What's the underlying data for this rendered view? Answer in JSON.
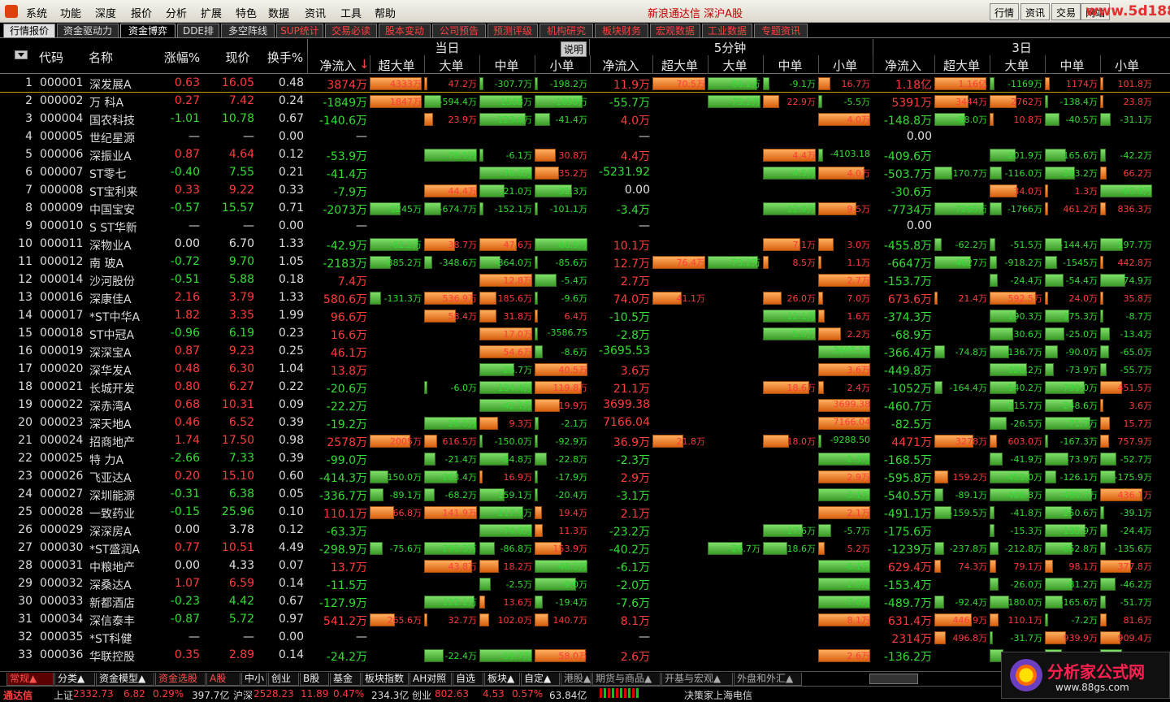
{
  "menubar": {
    "items": [
      "系统",
      "功能",
      "深度",
      "报价",
      "分析",
      "扩展",
      "特色",
      "数据",
      "资讯",
      "工具",
      "帮助"
    ],
    "brand": "新浪通达信 深沪A股",
    "right_buttons": [
      "行情",
      "资讯",
      "交易",
      "网站"
    ],
    "watermark": "www.5d188.com"
  },
  "tabs": [
    "行情报价",
    "资金驱动力",
    "资金博弈",
    "DDE排名",
    "多空阵线",
    "SUP统计",
    "交易必读",
    "股本变动",
    "公司预告",
    "预测评级",
    "机构研究",
    "板块财务",
    "宏观数据",
    "工业数据",
    "专题资讯"
  ],
  "header": {
    "groups": [
      "当日",
      "5分钟",
      "3日"
    ],
    "explain_button": "说明",
    "left_cols": [
      "代码",
      "名称",
      "涨幅%",
      "现价",
      "换手%"
    ],
    "sub_cols": [
      "净流入",
      "超大单",
      "大单",
      "中单",
      "小单"
    ],
    "sort_mark": "↓"
  },
  "colors": {
    "up": "#ff3b3b",
    "down": "#33dd33",
    "flat": "#e0e0e0",
    "bar_green": "#52c23a",
    "bar_orange": "#f08a30"
  },
  "rows": [
    [
      "1",
      "000001",
      "深发展A",
      "0.63",
      "16.05",
      "0.48",
      "3874万",
      "4333万",
      "47.2万",
      "-307.7万",
      "-198.2万",
      "11.9万",
      "70.5万",
      "-66.2万",
      "-9.1万",
      "16.7万",
      "1.18亿",
      "1.16亿",
      "-1169万",
      "1174万",
      "101.8万"
    ],
    [
      "2",
      "000002",
      "万 科A",
      "0.27",
      "7.42",
      "0.24",
      "-1849万",
      "1847万",
      "-594.4万",
      "-1508万",
      "-1690万",
      "-55.7万",
      "",
      "-73.2万",
      "22.9万",
      "-5.5万",
      "5391万",
      "3444万",
      "2762万",
      "-138.4万",
      "23.8万"
    ],
    [
      "3",
      "000004",
      "国农科技",
      "-1.01",
      "10.78",
      "0.67",
      "-140.6万",
      "",
      "23.9万",
      "-123.0万",
      "-41.4万",
      "4.0万",
      "",
      "",
      "",
      "4.0万",
      "-148.8万",
      "-88.0万",
      "10.8万",
      "-40.5万",
      "-31.1万"
    ],
    [
      "4",
      "000005",
      "世纪星源",
      "—",
      "—",
      "0.00",
      "—",
      "",
      "",
      "",
      "",
      "—",
      "",
      "",
      "",
      "",
      "0.00",
      "",
      "",
      "",
      ""
    ],
    [
      "5",
      "000006",
      "深振业A",
      "0.87",
      "4.64",
      "0.12",
      "-53.9万",
      "",
      "-78.5万",
      "-6.1万",
      "30.8万",
      "4.4万",
      "",
      "",
      "4.4万",
      "-4103.18",
      "-409.6万",
      "",
      "-201.9万",
      "-165.6万",
      "-42.2万"
    ],
    [
      "6",
      "000007",
      "ST零七",
      "-0.40",
      "7.55",
      "0.21",
      "-41.4万",
      "",
      "",
      "-76.6万",
      "35.2万",
      "-5231.92",
      "",
      "",
      "-4.5万",
      "4.0万",
      "-503.7万",
      "-170.7万",
      "-116.0万",
      "-283.2万",
      "66.2万"
    ],
    [
      "7",
      "000008",
      "ST宝利来",
      "0.33",
      "9.22",
      "0.33",
      "-7.9万",
      "",
      "44.4万",
      "-21.0万",
      "-31.3万",
      "0.00",
      "",
      "",
      "",
      "",
      "-30.6万",
      "",
      "34.0万",
      "1.3万",
      "-65.8万"
    ],
    [
      "8",
      "000009",
      "中国宝安",
      "-0.57",
      "15.57",
      "0.71",
      "-2073万",
      "-1245万",
      "-674.7万",
      "-152.1万",
      "-101.1万",
      "-3.4万",
      "",
      "",
      "-12.9万",
      "9.5万",
      "-7734万",
      "-7265万",
      "-1766万",
      "461.2万",
      "836.3万"
    ],
    [
      "9",
      "000010",
      "S ST华新",
      "—",
      "—",
      "0.00",
      "—",
      "",
      "",
      "",
      "",
      "—",
      "",
      "",
      "",
      "",
      "0.00",
      "",
      "",
      "",
      ""
    ],
    [
      "10",
      "000011",
      "深物业A",
      "0.00",
      "6.70",
      "1.33",
      "-42.9万",
      "-62.2万",
      "38.7万",
      "47.6万",
      "-66.9万",
      "10.1万",
      "",
      "",
      "7.1万",
      "3.0万",
      "-455.8万",
      "-62.2万",
      "-51.5万",
      "-144.4万",
      "-197.7万"
    ],
    [
      "11",
      "000012",
      "南 玻A",
      "-0.72",
      "9.70",
      "1.05",
      "-2183万",
      "-885.2万",
      "-348.6万",
      "-864.0万",
      "-85.6万",
      "12.7万",
      "76.4万",
      "-73.2万",
      "8.5万",
      "1.1万",
      "-6647万",
      "-4627万",
      "-918.2万",
      "-1545万",
      "442.8万"
    ],
    [
      "12",
      "000014",
      "沙河股份",
      "-0.51",
      "5.88",
      "0.18",
      "7.4万",
      "",
      "",
      "12.8万",
      "-5.4万",
      "2.7万",
      "",
      "",
      "",
      "2.7万",
      "-153.7万",
      "",
      "-24.4万",
      "-54.4万",
      "-74.9万"
    ],
    [
      "13",
      "000016",
      "深康佳A",
      "2.16",
      "3.79",
      "1.33",
      "580.6万",
      "-131.3万",
      "536.9万",
      "185.6万",
      "-9.6万",
      "74.0万",
      "41.1万",
      "",
      "26.0万",
      "7.0万",
      "673.6万",
      "21.4万",
      "592.5万",
      "24.0万",
      "35.8万"
    ],
    [
      "14",
      "000017",
      "*ST中华A",
      "1.82",
      "3.35",
      "1.99",
      "96.6万",
      "",
      "58.4万",
      "31.8万",
      "6.4万",
      "-10.5万",
      "",
      "",
      "-12.1万",
      "1.6万",
      "-374.3万",
      "",
      "-190.3万",
      "-175.3万",
      "-8.7万"
    ],
    [
      "15",
      "000018",
      "ST中冠A",
      "-0.96",
      "6.19",
      "0.23",
      "16.6万",
      "",
      "",
      "17.0万",
      "-3586.75",
      "-2.8万",
      "",
      "",
      "-5.0万",
      "2.2万",
      "-68.9万",
      "",
      "-30.6万",
      "-25.0万",
      "-13.4万"
    ],
    [
      "16",
      "000019",
      "深深宝A",
      "0.87",
      "9.23",
      "0.25",
      "46.1万",
      "",
      "",
      "54.6万",
      "-8.6万",
      "-3695.53",
      "",
      "",
      "",
      "-3695.53",
      "-366.4万",
      "-74.8万",
      "-136.7万",
      "-90.0万",
      "-65.0万"
    ],
    [
      "17",
      "000020",
      "深华发A",
      "0.48",
      "6.30",
      "1.04",
      "13.8万",
      "",
      "",
      "-26.7万",
      "40.5万",
      "3.6万",
      "",
      "",
      "",
      "3.6万",
      "-449.8万",
      "",
      "-320.2万",
      "-73.9万",
      "-55.7万"
    ],
    [
      "18",
      "000021",
      "长城开发",
      "0.80",
      "6.27",
      "0.22",
      "-20.6万",
      "",
      "-6.0万",
      "-134.4万",
      "119.8万",
      "21.1万",
      "",
      "",
      "18.6万",
      "2.4万",
      "-1052万",
      "-164.4万",
      "-540.2万",
      "-799.0万",
      "451.5万"
    ],
    [
      "19",
      "000022",
      "深赤湾A",
      "0.68",
      "10.31",
      "0.09",
      "-22.2万",
      "",
      "",
      "-42.1万",
      "19.9万",
      "3699.38",
      "",
      "",
      "",
      "3699.38",
      "-460.7万",
      "",
      "-215.7万",
      "-248.6万",
      "3.6万"
    ],
    [
      "20",
      "000023",
      "深天地A",
      "0.46",
      "6.52",
      "0.39",
      "-19.2万",
      "",
      "-26.5万",
      "9.3万",
      "-2.1万",
      "7166.04",
      "",
      "",
      "",
      "7166.04",
      "-82.5万",
      "",
      "-26.5万",
      "-71.7万",
      "15.7万"
    ],
    [
      "21",
      "000024",
      "招商地产",
      "1.74",
      "17.50",
      "0.98",
      "2578万",
      "2005万",
      "616.5万",
      "-150.0万",
      "-92.9万",
      "36.9万",
      "21.8万",
      "",
      "18.0万",
      "-9288.50",
      "4471万",
      "3278万",
      "603.0万",
      "-167.3万",
      "757.9万"
    ],
    [
      "22",
      "000025",
      "特 力A",
      "-2.66",
      "7.33",
      "0.39",
      "-99.0万",
      "",
      "-21.4万",
      "-54.8万",
      "-22.8万",
      "-2.3万",
      "",
      "",
      "",
      "-2.3万",
      "-168.5万",
      "",
      "-41.9万",
      "-73.9万",
      "-52.7万"
    ],
    [
      "23",
      "000026",
      "飞亚达A",
      "0.20",
      "15.10",
      "0.60",
      "-414.3万",
      "-150.0万",
      "-263.4万",
      "16.9万",
      "-17.9万",
      "2.9万",
      "",
      "",
      "",
      "2.9万",
      "-595.8万",
      "159.2万",
      "-453.0万",
      "-126.1万",
      "-175.9万"
    ],
    [
      "24",
      "000027",
      "深圳能源",
      "-0.31",
      "6.38",
      "0.05",
      "-336.7万",
      "-89.1万",
      "-68.2万",
      "-159.1万",
      "-20.4万",
      "-3.1万",
      "",
      "",
      "",
      "-3.1万",
      "-540.5万",
      "-89.1万",
      "-406.8万",
      "-480.7万",
      "436.1万"
    ],
    [
      "25",
      "000028",
      "一致药业",
      "-0.15",
      "25.96",
      "0.10",
      "110.1万",
      "66.8万",
      "141.9万",
      "-117.9万",
      "19.4万",
      "2.1万",
      "",
      "",
      "",
      "2.1万",
      "-491.1万",
      "-159.5万",
      "-41.8万",
      "-250.6万",
      "-39.1万"
    ],
    [
      "26",
      "000029",
      "深深房A",
      "0.00",
      "3.78",
      "0.12",
      "-63.3万",
      "",
      "",
      "-74.6万",
      "11.3万",
      "-23.2万",
      "",
      "",
      "-17.6万",
      "-5.7万",
      "-175.6万",
      "",
      "-15.3万",
      "-135.9万",
      "-24.4万"
    ],
    [
      "27",
      "000030",
      "*ST盛润A",
      "0.77",
      "10.51",
      "4.49",
      "-298.9万",
      "-75.6万",
      "-290.3万",
      "-86.8万",
      "153.9万",
      "-40.2万",
      "",
      "-26.7万",
      "-18.6万",
      "5.2万",
      "-1239万",
      "-237.8万",
      "-212.8万",
      "-652.8万",
      "-135.6万"
    ],
    [
      "28",
      "000031",
      "中粮地产",
      "0.00",
      "4.33",
      "0.07",
      "13.7万",
      "",
      "43.8万",
      "18.2万",
      "-48.3万",
      "-6.1万",
      "",
      "",
      "",
      "-6.1万",
      "629.4万",
      "74.3万",
      "79.1万",
      "98.1万",
      "377.8万"
    ],
    [
      "29",
      "000032",
      "深桑达A",
      "1.07",
      "6.59",
      "0.14",
      "-11.5万",
      "",
      "",
      "-2.5万",
      "-9.0万",
      "-2.0万",
      "",
      "",
      "",
      "-2.0万",
      "-153.4万",
      "",
      "-26.0万",
      "-81.2万",
      "-46.2万"
    ],
    [
      "30",
      "000033",
      "新都酒店",
      "-0.23",
      "4.42",
      "0.67",
      "-127.9万",
      "",
      "-122.1万",
      "13.6万",
      "-19.4万",
      "-7.6万",
      "",
      "",
      "",
      "-7.6万",
      "-489.7万",
      "-92.4万",
      "-180.0万",
      "-165.6万",
      "-51.7万"
    ],
    [
      "31",
      "000034",
      "深信泰丰",
      "-0.87",
      "5.72",
      "0.97",
      "541.2万",
      "265.6万",
      "32.7万",
      "102.0万",
      "140.7万",
      "8.1万",
      "",
      "",
      "",
      "8.1万",
      "631.4万",
      "446.9万",
      "110.1万",
      "-7.2万",
      "81.6万"
    ],
    [
      "32",
      "000035",
      "*ST科健",
      "—",
      "—",
      "0.00",
      "—",
      "",
      "",
      "",
      "",
      "—",
      "",
      "",
      "",
      "",
      "2314万",
      "496.8万",
      "-31.7万",
      "939.9万",
      "909.4万"
    ],
    [
      "33",
      "000036",
      "华联控股",
      "0.35",
      "2.89",
      "0.14",
      "-24.2万",
      "",
      "-22.4万",
      "-59.7万",
      "58.0万",
      "2.6万",
      "",
      "",
      "",
      "2.6万",
      "-136.2万",
      "",
      "-36.1万",
      "-43.2万",
      "-56.9万"
    ]
  ],
  "bottom_tabs": [
    "常规▲",
    "分类▲",
    "资金模型▲",
    "资金选股",
    "A股",
    "中小",
    "创业",
    "B股",
    "基金",
    "板块指数",
    "AH对照",
    "自选",
    "板块▲",
    "自定▲",
    "港股▲",
    "期货与商品▲",
    "开基与宏观▲",
    "外盘和外汇▲"
  ],
  "status": {
    "brand": "通达信",
    "sh_label": "上证",
    "sh_index": "2332.73",
    "sh_chg": "6.82",
    "sh_pct": "0.29%",
    "sh_amt": "397.7亿",
    "sz_label": "沪深",
    "sz_index": "2528.23",
    "sz_chg": "11.89",
    "sz_pct": "0.47%",
    "sz_amt": "234.3亿",
    "cy_label": "创业",
    "cy_index": "802.63",
    "cy_chg": "4.53",
    "cy_pct": "0.57%",
    "cy_amt": "63.84亿",
    "info": "决策家上海电信"
  },
  "brand_box": {
    "title": "分析家公式网",
    "url": "www.88gs.com"
  }
}
